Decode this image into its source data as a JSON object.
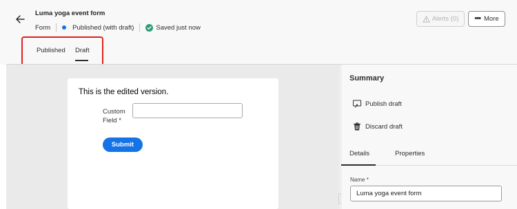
{
  "header": {
    "title": "Luma yoga event form",
    "type_label": "Form",
    "status": "Published (with draft)",
    "save_status": "Saved just now",
    "alerts_label": "Alerts (0)",
    "more_label": "More"
  },
  "tabs": [
    {
      "label": "Published",
      "selected": false
    },
    {
      "label": "Draft",
      "selected": true
    }
  ],
  "form": {
    "heading": "This is the edited version.",
    "field_label": "Custom Field *",
    "field_value": "",
    "submit_label": "Submit"
  },
  "panel": {
    "title": "Summary",
    "actions": [
      {
        "label": "Publish draft",
        "icon": "publish-icon"
      },
      {
        "label": "Discard draft",
        "icon": "trash-icon"
      }
    ],
    "tabs": [
      {
        "label": "Details",
        "selected": true
      },
      {
        "label": "Properties",
        "selected": false
      }
    ],
    "name_label": "Name *",
    "name_value": "Luma yoga event form"
  },
  "colors": {
    "accent": "#1473e6",
    "status_dot": "#1473e6",
    "saved_check": "#2d9d78",
    "highlight": "#e0201c"
  }
}
